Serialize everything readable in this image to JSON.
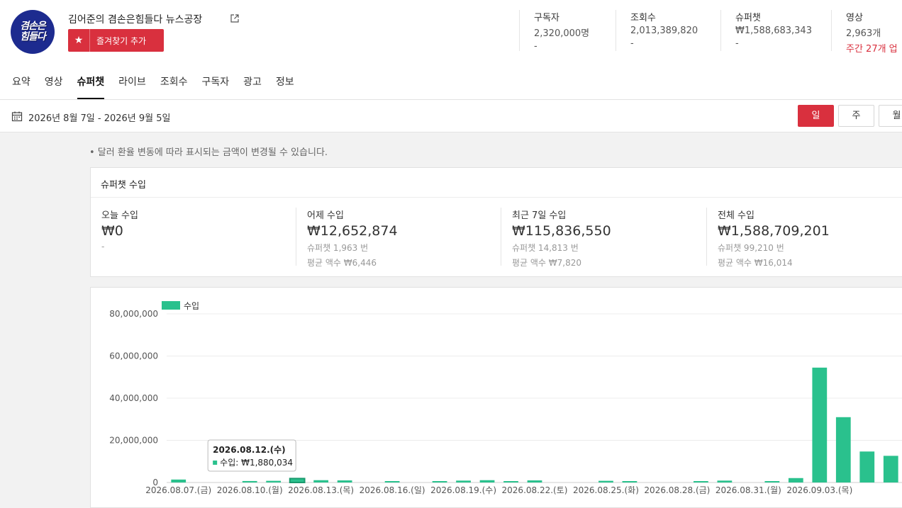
{
  "channel": {
    "name": "김어준의 겸손은힘들다 뉴스공장",
    "logo_lines": [
      "겸손은",
      "힘들다"
    ],
    "favorite_label": "즐겨찾기 추가"
  },
  "stats": [
    {
      "label": "구독자",
      "value": "2,320,000명",
      "sub": "-"
    },
    {
      "label": "조회수",
      "value": "2,013,389,820",
      "sub": "-"
    },
    {
      "label": "슈퍼챗",
      "value": "₩1,588,683,343",
      "sub": "-"
    },
    {
      "label": "영상",
      "value": "2,963개",
      "sub": "주간 27개 업"
    }
  ],
  "tabs": [
    "요약",
    "영상",
    "슈퍼챗",
    "라이브",
    "조회수",
    "구독자",
    "광고",
    "정보"
  ],
  "active_tab": "슈퍼챗",
  "date_range": "2026년 8월 7일 - 2026년 9월 5일",
  "period_buttons": [
    "일",
    "주",
    "월"
  ],
  "notice": "• 달러 환율 변동에 따라 표시되는 금액이 변경될 수 있습니다.",
  "income_card": {
    "title": "슈퍼챗 수입",
    "columns": [
      {
        "label": "오늘 수입",
        "amount": "₩0",
        "line1": "-",
        "line2": ""
      },
      {
        "label": "어제 수입",
        "amount": "₩12,652,874",
        "line1": "슈퍼챗 1,963 번",
        "line2": "평균 액수 ₩6,446"
      },
      {
        "label": "최근 7일 수입",
        "amount": "₩115,836,550",
        "line1": "슈퍼챗 14,813 번",
        "line2": "평균 액수 ₩7,820"
      },
      {
        "label": "전체 수입",
        "amount": "₩1,588,709,201",
        "line1": "슈퍼챗 99,210 번",
        "line2": "평균 액수 ₩16,014"
      }
    ]
  },
  "colors": {
    "accent": "#d9303e",
    "bar": "#2ac18d",
    "logo_bg": "#1d2b8f"
  },
  "chart_data": {
    "type": "bar",
    "series": [
      {
        "name": "수입",
        "values": [
          1400000,
          0,
          0,
          700000,
          800000,
          1880034,
          1100000,
          1000000,
          0,
          500000,
          0,
          600000,
          900000,
          1100000,
          600000,
          1000000,
          0,
          0,
          800000,
          500000,
          0,
          0,
          600000,
          900000,
          0,
          200000,
          2100000,
          54500000,
          31000000,
          14700000,
          12652874
        ]
      }
    ],
    "categories": [
      "08.07",
      "08.08",
      "08.09",
      "08.10",
      "08.11",
      "08.12",
      "08.13",
      "08.14",
      "08.15",
      "08.16",
      "08.17",
      "08.18",
      "08.19",
      "08.20",
      "08.21",
      "08.22",
      "08.23",
      "08.24",
      "08.25",
      "08.26",
      "08.27",
      "08.28",
      "08.29",
      "08.30",
      "08.31",
      "09.01",
      "09.02",
      "09.03",
      "09.04",
      "09.05",
      "09.06"
    ],
    "x_tick_labels": [
      "2026.08.07.(금)",
      "2026.08.10.(월)",
      "2026.08.13.(목)",
      "2026.08.16.(일)",
      "2026.08.19.(수)",
      "2026.08.22.(토)",
      "2026.08.25.(화)",
      "2026.08.28.(금)",
      "2026.08.31.(월)",
      "2026.09.03.(목)"
    ],
    "y_ticks": [
      "0",
      "20,000,000",
      "40,000,000",
      "60,000,000",
      "80,000,000"
    ],
    "ylim": [
      0,
      80000000
    ],
    "grid": true,
    "legend": "top-left",
    "tooltip": {
      "title": "2026.08.12.(수)",
      "label": "수입: ₩1,880,034",
      "index": 5
    }
  }
}
